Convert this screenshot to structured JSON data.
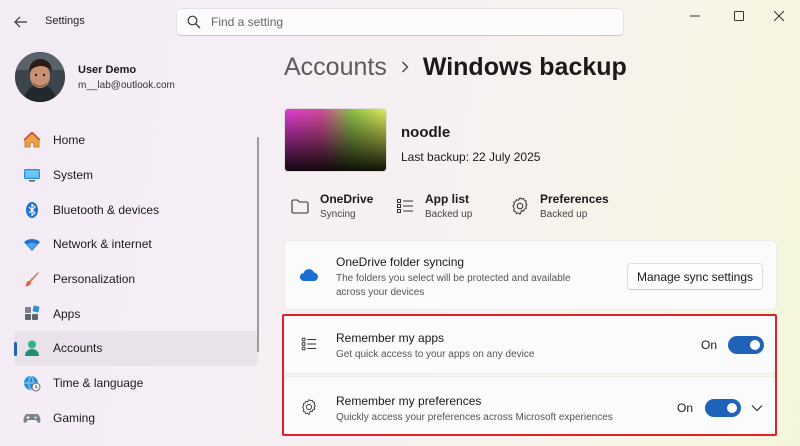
{
  "window": {
    "title": "Settings",
    "search_placeholder": "Find a setting"
  },
  "user": {
    "name": "User Demo",
    "email": "m__lab@outlook.com"
  },
  "nav": {
    "items": [
      {
        "label": "Home",
        "icon": "home-icon"
      },
      {
        "label": "System",
        "icon": "system-icon"
      },
      {
        "label": "Bluetooth & devices",
        "icon": "bluetooth-icon"
      },
      {
        "label": "Network & internet",
        "icon": "wifi-icon"
      },
      {
        "label": "Personalization",
        "icon": "brush-icon"
      },
      {
        "label": "Apps",
        "icon": "apps-icon"
      },
      {
        "label": "Accounts",
        "icon": "accounts-icon",
        "active": true
      },
      {
        "label": "Time & language",
        "icon": "globe-clock-icon"
      },
      {
        "label": "Gaming",
        "icon": "gamepad-icon"
      }
    ]
  },
  "breadcrumb": {
    "parent": "Accounts",
    "current": "Windows backup"
  },
  "device": {
    "name": "noodle",
    "last_backup": "Last backup: 22 July 2025"
  },
  "stats": [
    {
      "title": "OneDrive",
      "sub": "Syncing",
      "icon": "folder-icon"
    },
    {
      "title": "App list",
      "sub": "Backed up",
      "icon": "app-list-icon"
    },
    {
      "title": "Preferences",
      "sub": "Backed up",
      "icon": "gear-icon"
    }
  ],
  "onedrive_card": {
    "title": "OneDrive folder syncing",
    "desc_line1": "The folders you select will be protected and available",
    "desc_line2": "across your devices",
    "button": "Manage sync settings",
    "icon": "cloud-icon"
  },
  "apps_card": {
    "title": "Remember my apps",
    "desc": "Get quick access to your apps on any device",
    "state": "On",
    "icon": "app-list-icon"
  },
  "prefs_card": {
    "title": "Remember my preferences",
    "desc": "Quickly access your preferences across Microsoft experiences",
    "state": "On",
    "icon": "gear-icon"
  },
  "colors": {
    "accent": "#1f62b8",
    "highlight": "#e0202a"
  }
}
